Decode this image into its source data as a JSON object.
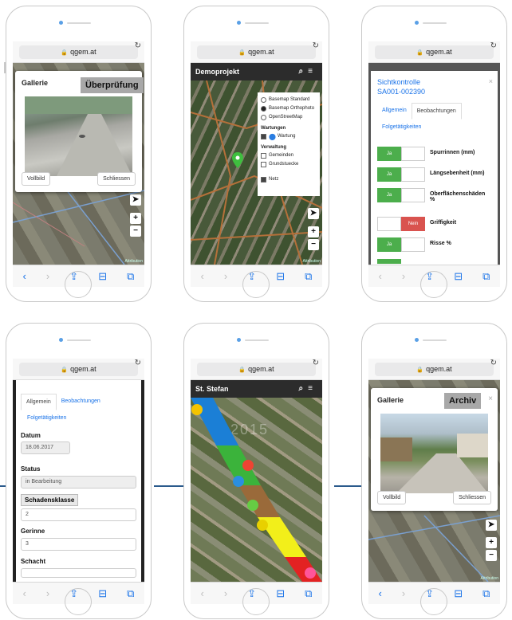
{
  "browser": {
    "url": "qgem.at",
    "reload_icon": "reload-icon",
    "tab_icons": [
      "‹",
      "›",
      "⇪",
      "⊟",
      "⧉"
    ]
  },
  "phone1": {
    "modal_title": "Gallerie",
    "tag": "Überprüfung",
    "close": "×",
    "fullscreen_label": "Vollbild",
    "close_label": "Schliessen",
    "attribution": "Attribution"
  },
  "phone2": {
    "app_title": "Demoprojekt",
    "layers": {
      "basemaps": [
        "Basemap Standard",
        "Basemap Orthophoto",
        "OpenStreetMap"
      ],
      "basemap_selected": 1,
      "group_wartungen": "Wartungen",
      "wartung": "Wartung",
      "group_verwaltung": "Verwaltung",
      "verwaltung_items": [
        "Gemeinden",
        "Grundstuecke"
      ],
      "netz": "Netz"
    },
    "attribution": "Attribution"
  },
  "phone3": {
    "title_line1": "Sichtkontrolle",
    "title_line2": "SA001-002390",
    "tabs": [
      "Allgemein",
      "Beobachtungen",
      "Folgetätigkeiten"
    ],
    "rows": [
      {
        "yes": "Ja",
        "no": "",
        "state": "yes",
        "label": "Spurrinnen (mm)"
      },
      {
        "yes": "Ja",
        "no": "",
        "state": "yes",
        "label": "Längsebenheit (mm)"
      },
      {
        "yes": "Ja",
        "no": "",
        "state": "yes",
        "label": "Oberflächenschäden %"
      },
      {
        "yes": "",
        "no": "Nein",
        "state": "no",
        "label": "Griffigkeit"
      },
      {
        "yes": "Ja",
        "no": "",
        "state": "yes",
        "label": "Risse %"
      }
    ]
  },
  "phone4": {
    "tabs": [
      "Allgemein",
      "Beobachtungen",
      "Folgetätigkeiten"
    ],
    "datum_label": "Datum",
    "datum_value": "18.06.2017",
    "status_label": "Status",
    "status_value": "in Bearbeitung",
    "schadensklasse_label": "Schadensklasse",
    "schadensklasse_value": "2",
    "gerinne_label": "Gerinne",
    "gerinne_value": "3",
    "schacht_label": "Schacht"
  },
  "phone5": {
    "app_title": "St. Stefan",
    "watermark": "2015"
  },
  "phone6": {
    "modal_title": "Gallerie",
    "tag": "Archiv",
    "close": "×",
    "fullscreen_label": "Vollbild",
    "close_label": "Schliessen",
    "attribution": "Attribution"
  },
  "colors": {
    "accent": "#1a73e8",
    "connector": "#2a5a8c",
    "yes_green": "#4cae4c",
    "no_red": "#d9534f",
    "header_dark": "#2c2c2c"
  }
}
